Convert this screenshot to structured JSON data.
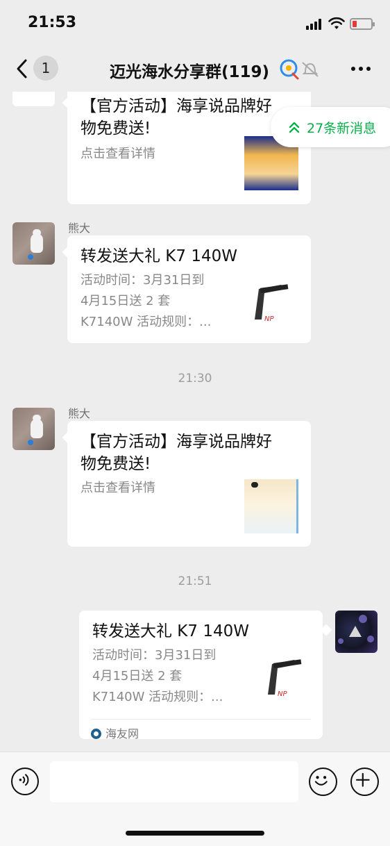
{
  "status_bar": {
    "time": "21:53",
    "battery_color": "#e53935"
  },
  "nav": {
    "unread_count": "1",
    "title": "迈光海水分享群(119)",
    "icons": [
      "back-chevron-icon",
      "chat-bubble-icon",
      "mute-bell-icon",
      "more-icon"
    ]
  },
  "new_messages": {
    "label": "27条新消息",
    "color": "#07b04a"
  },
  "messages": [
    {
      "sender": "",
      "title": "【官方活动】海享说品牌好物免费送!",
      "title_line1": "【官方活动】海享说品牌好",
      "title_line2": "物免费送!",
      "desc": "点击查看详情"
    },
    {
      "sender": "熊大",
      "title": "转发送大礼 K7 140W",
      "desc_line1": "活动时间：3月31日到",
      "desc_line2": "4月15日送 2 套",
      "desc_line3": "K7140W 活动规则：..."
    },
    {
      "time_separator": "21:30"
    },
    {
      "sender": "熊大",
      "title_line1": "【官方活动】海享说品牌好",
      "title_line2": "物免费送!",
      "desc": "点击查看详情"
    },
    {
      "time_separator": "21:51"
    },
    {
      "sender": "me",
      "title": "转发送大礼 K7 140W",
      "desc_line1": "活动时间：3月31日到",
      "desc_line2": "4月15日送 2 套",
      "desc_line3": "K7140W 活动规则：...",
      "source": "海友网"
    }
  ],
  "input_bar": {
    "icons": [
      "voice-icon",
      "emoji-icon",
      "plus-icon"
    ],
    "placeholder": ""
  }
}
